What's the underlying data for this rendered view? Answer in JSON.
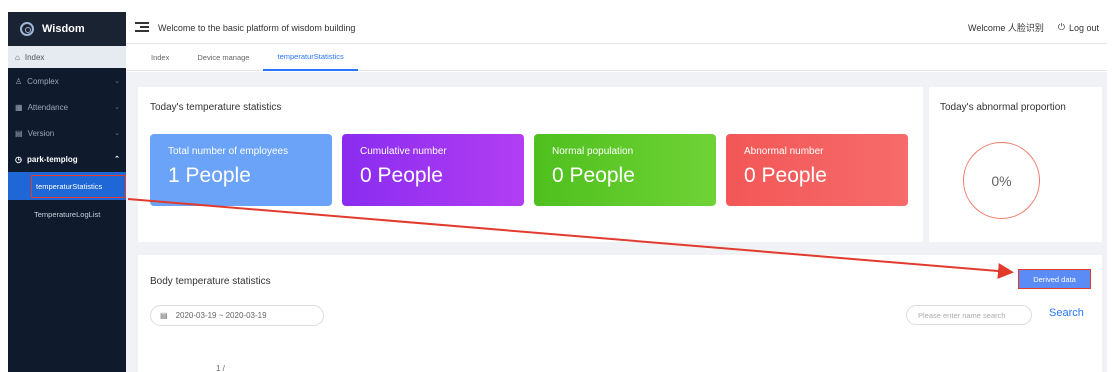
{
  "sidebar": {
    "logo": "Wisdom",
    "index": "Index",
    "items": [
      {
        "label": "Complex"
      },
      {
        "label": "Attendance"
      },
      {
        "label": "Version"
      },
      {
        "label": "park-templog"
      }
    ],
    "sub_items": [
      {
        "label": "temperaturStatistics",
        "active": true
      },
      {
        "label": "TemperatureLogList",
        "active": false
      }
    ]
  },
  "header": {
    "title": "Welcome to the basic platform of wisdom building",
    "welcome": "Welcome 人脸识别",
    "logout": "Log out"
  },
  "tabs": [
    "Index",
    "Device manage",
    "temperaturStatistics"
  ],
  "today_stats": {
    "title": "Today's temperature statistics",
    "cards": [
      {
        "label": "Total number of employees",
        "value": "1 People",
        "color": "#6aa3f7"
      },
      {
        "label": "Cumulative number",
        "value": "0 People",
        "color": "#9b2df1"
      },
      {
        "label": "Normal population",
        "value": "0 People",
        "color": "#58c824"
      },
      {
        "label": "Abnormal number",
        "value": "0 People",
        "color": "#f35d5d"
      }
    ]
  },
  "abnormal": {
    "title": "Today's abnormal proportion",
    "value": "0%"
  },
  "body_stats": {
    "title": "Body temperature statistics",
    "derived_button": "Derived data",
    "date_range": "2020-03-19 ~ 2020-03-19",
    "search_placeholder": "Please enter name search",
    "search_button": "Search",
    "y_tick": "1 /"
  },
  "colors": {
    "sidebar_bg": "#0f1b2d",
    "accent": "#2878ff",
    "annotation": "#e23b2e"
  }
}
